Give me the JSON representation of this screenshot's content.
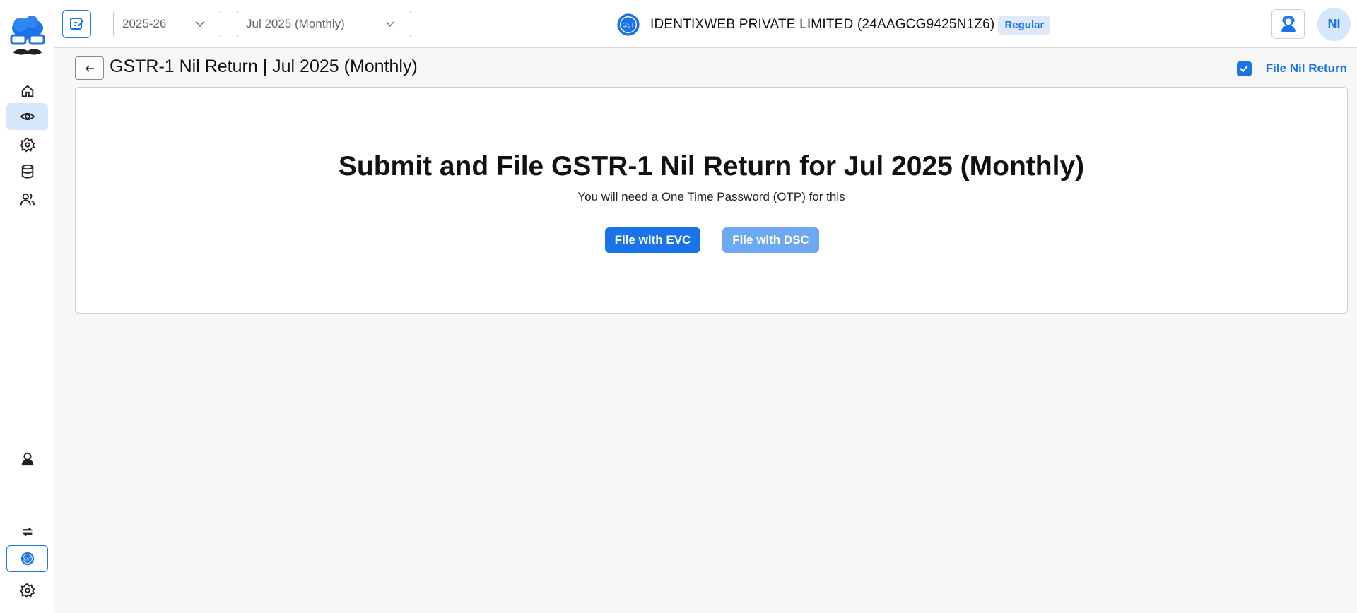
{
  "header": {
    "financial_year": "2025-26",
    "period": "Jul 2025 (Monthly)",
    "company_name": "IDENTIXWEB PRIVATE LIMITED (24AAGCG9425N1Z6)",
    "taxpayer_type": "Regular",
    "avatar_initials": "NI"
  },
  "page": {
    "title": "GSTR-1 Nil Return | Jul 2025 (Monthly)",
    "nil_return_label": "File Nil Return",
    "nil_return_checked": true
  },
  "card": {
    "heading": "Submit and File GSTR-1 Nil Return for Jul 2025 (Monthly)",
    "subtext": "You will need a One Time Password (OTP) for this",
    "evc_button": "File with EVC",
    "dsc_button": "File with DSC"
  },
  "sidebar": {
    "items": [
      "home-icon",
      "eye-icon",
      "gear-icon",
      "database-icon",
      "users-icon"
    ],
    "bottom_items": [
      "support-agent-icon",
      "switch-icon",
      "gst-seal-icon",
      "settings-icon"
    ],
    "active_item": "eye-icon"
  },
  "colors": {
    "accent": "#1a73e8",
    "accent_light": "#d6e6fb",
    "disabled_button": "#6ea8f0",
    "background": "#f7f7f7"
  }
}
